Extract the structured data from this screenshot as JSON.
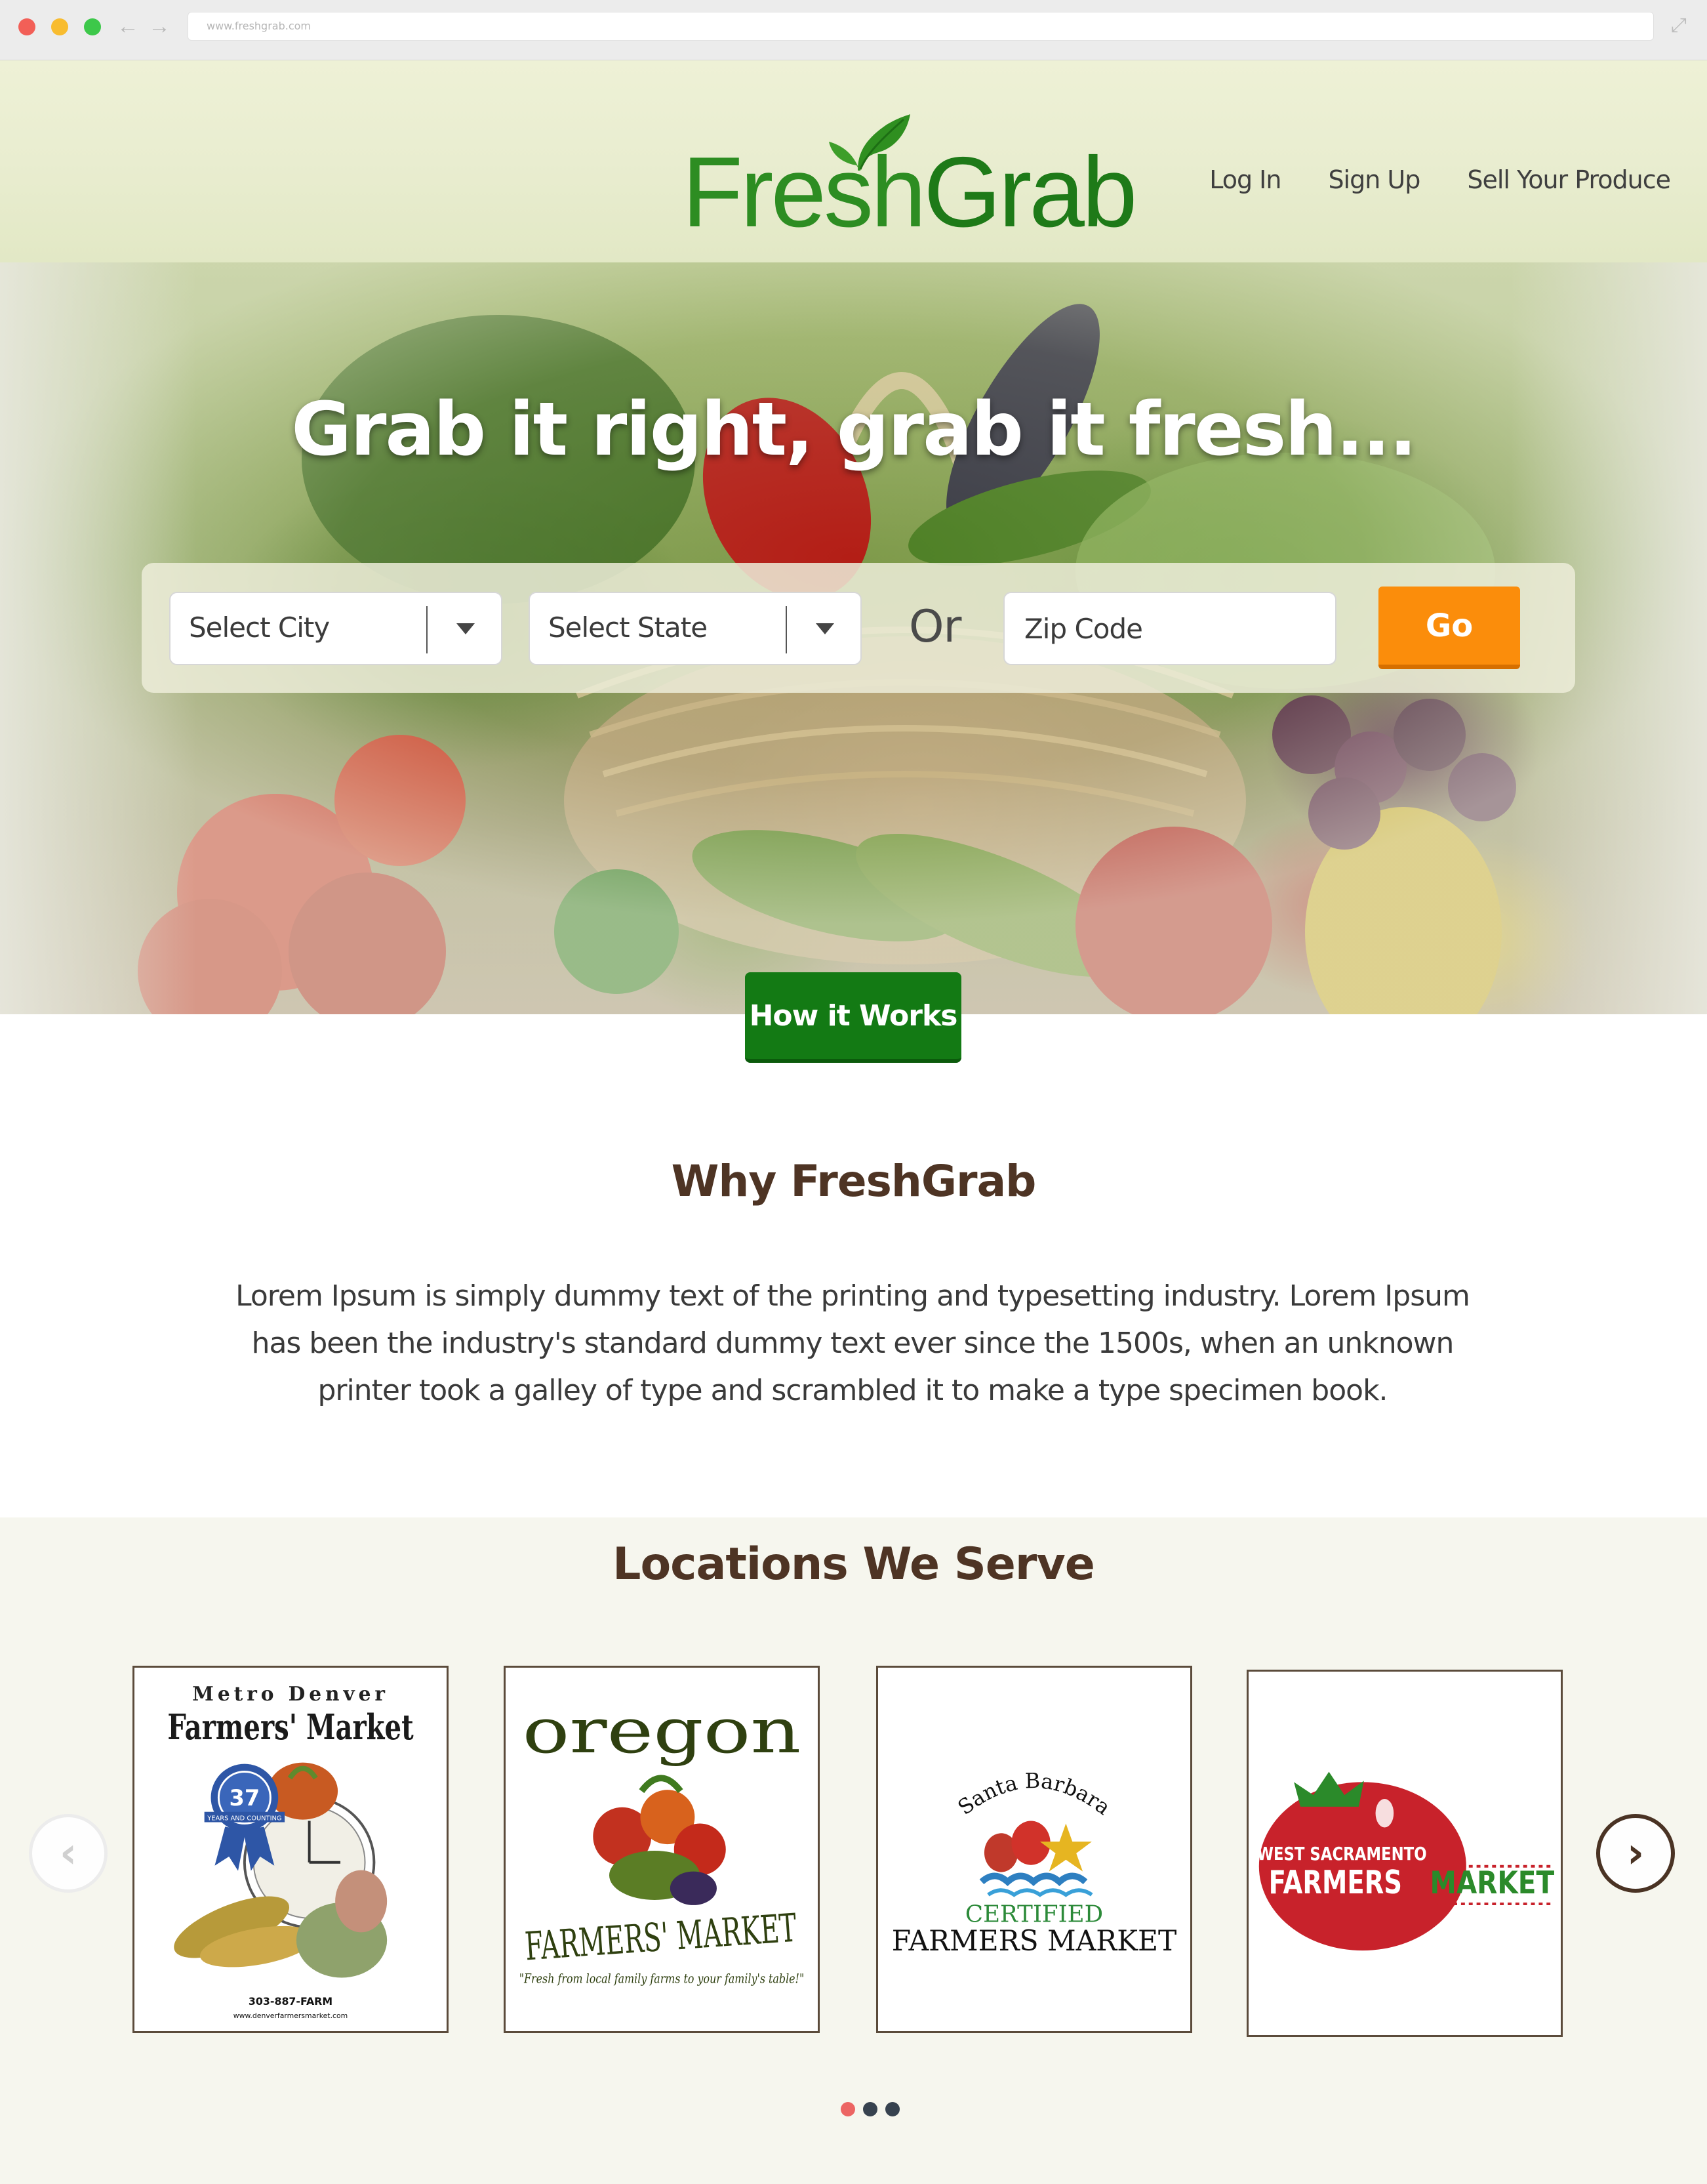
{
  "browser": {
    "url": "www.freshgrab.com",
    "back_glyph": "←",
    "forward_glyph": "→",
    "expand_glyph": "⤢"
  },
  "header": {
    "logo_part1": "Fresh",
    "logo_part2": "Grab",
    "nav": [
      "Log In",
      "Sign Up",
      "Sell Your Produce"
    ]
  },
  "hero": {
    "title": "Grab it right, grab it fresh...",
    "city_select": "Select City",
    "state_select": "Select State",
    "or_label": "Or",
    "zip_placeholder": "Zip Code",
    "go_label": "Go",
    "how_label": "How it Works"
  },
  "why": {
    "title": "Why FreshGrab",
    "body": "Lorem Ipsum is simply dummy text of the printing and typesetting industry. Lorem Ipsum has been the industry's standard dummy text ever since the 1500s, when an unknown printer took a galley of type and scrambled it to make a type specimen book."
  },
  "locations": {
    "title": "Locations We Serve",
    "prev_glyph": "‹",
    "next_glyph": "›",
    "cards": [
      {
        "line1": "Metro Denver",
        "line2": "Farmers' Market",
        "ribbon_number": "37",
        "ribbon_text": "YEARS AND COUNTING",
        "phone": "303-887-FARM",
        "site": "www.denverfarmersmarket.com"
      },
      {
        "line1": "oregon",
        "line2": "FARMERS' MARKET",
        "tagline": "\"Fresh from local family farms to your family's table!\""
      },
      {
        "line1": "Santa Barbara",
        "line2": "CERTIFIED",
        "line3": "FARMERS MARKET"
      },
      {
        "line1": "WEST SACRAMENTO",
        "line2": "FARMERS",
        "line3": "MARKET"
      }
    ],
    "active_dot": 0,
    "dot_count": 3
  },
  "colors": {
    "brand_green": "#258a1e",
    "go_orange": "#fb8d0b",
    "how_green": "#137a14",
    "heading_brown": "#4e3424",
    "dot_active": "#ec6563"
  }
}
